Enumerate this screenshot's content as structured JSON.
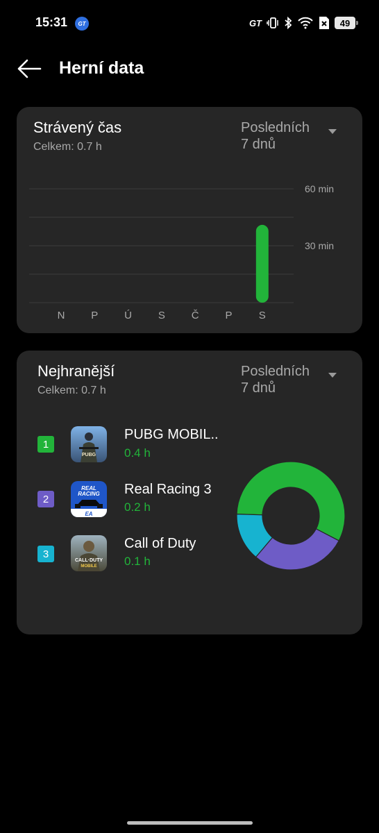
{
  "status_bar": {
    "time": "15:31",
    "badge": "GT",
    "gt_label": "GT",
    "battery": "49",
    "icons": [
      "gt-icon",
      "vibrate-icon",
      "bluetooth-icon",
      "wifi-icon",
      "no-sim-icon",
      "battery-icon"
    ]
  },
  "header": {
    "back_icon": "arrow-left-icon",
    "title": "Herní data"
  },
  "time_card": {
    "title": "Strávený čas",
    "subtitle": "Celkem: 0.7 h",
    "period_line1": "Posledních",
    "period_line2": "7 dnů",
    "period_icon": "dropdown-arrow-icon"
  },
  "top_card": {
    "title": "Nejhranější",
    "subtitle": "Celkem: 0.7 h",
    "period_line1": "Posledních",
    "period_line2": "7 dnů",
    "period_icon": "dropdown-arrow-icon",
    "games": [
      {
        "rank": "1",
        "name": "PUBG MOBIL..",
        "time": "0.4 h",
        "color": "#22b43a"
      },
      {
        "rank": "2",
        "name": "Real Racing 3",
        "time": "0.2 h",
        "color": "#6e5cc6"
      },
      {
        "rank": "3",
        "name": "Call of Duty",
        "time": "0.1 h",
        "color": "#17b3d0"
      }
    ],
    "icon_texts": {
      "pubg": "PUBG",
      "rr_line1": "REAL",
      "rr_line2": "RACING",
      "rr_brand": "EA",
      "cod_line1": "CALL·DUTY",
      "cod_line2": "MOBILE"
    }
  },
  "chart_data": [
    {
      "type": "bar",
      "categories": [
        "N",
        "P",
        "Ú",
        "S",
        "Č",
        "P",
        "S"
      ],
      "values": [
        0,
        0,
        0,
        0,
        0,
        0,
        41
      ],
      "y_ticks": [
        30,
        60
      ],
      "y_tick_labels": [
        "30 min",
        "60 min"
      ],
      "ylim": [
        0,
        60
      ],
      "grid": true,
      "bar_color": "#22b43a"
    },
    {
      "type": "pie",
      "categories": [
        "PUBG MOBIL..",
        "Real Racing 3",
        "Call of Duty"
      ],
      "values": [
        0.4,
        0.2,
        0.1
      ],
      "colors": [
        "#22b43a",
        "#6e5cc6",
        "#17b3d0"
      ]
    }
  ]
}
